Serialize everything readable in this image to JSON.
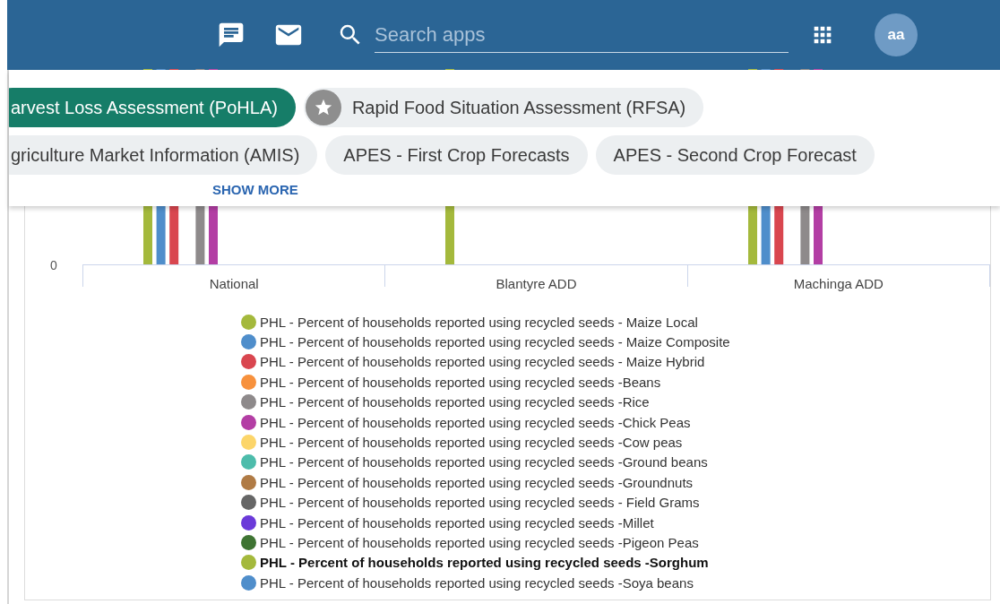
{
  "topbar": {
    "search": {
      "placeholder": "Search apps"
    },
    "avatar": "aa"
  },
  "app_chips": {
    "rows": [
      {
        "chips": [
          {
            "label": "arvest Loss Assessment (PoHLA)",
            "selected": true,
            "kind": "plain"
          },
          {
            "label": "Rapid Food Situation Assessment (RFSA)",
            "selected": false,
            "kind": "starred"
          }
        ]
      },
      {
        "chips": [
          {
            "label": "griculture Market Information (AMIS)",
            "selected": false,
            "kind": "plain"
          },
          {
            "label": "APES - First Crop Forecasts",
            "selected": false,
            "kind": "plain"
          },
          {
            "label": "APES - Second Crop Forecast",
            "selected": false,
            "kind": "plain"
          }
        ]
      }
    ],
    "show_more": "SHOW MORE"
  },
  "chart": {
    "y_tick": "0",
    "categories": [
      "National",
      "Blantyre ADD",
      "Machinga ADD"
    ],
    "legend": [
      {
        "label": "PHL - Percent of households reported using recycled seeds - Maize Local",
        "color": "#a4b93c",
        "highlighted": false
      },
      {
        "label": "PHL - Percent of households reported using recycled seeds - Maize Composite",
        "color": "#4f8ecb",
        "highlighted": false
      },
      {
        "label": "PHL - Percent of households reported using recycled seeds - Maize Hybrid",
        "color": "#d9464f",
        "highlighted": false
      },
      {
        "label": "PHL - Percent of households reported using recycled seeds -Beans",
        "color": "#f7913d",
        "highlighted": false
      },
      {
        "label": "PHL - Percent of households reported using recycled seeds -Rice",
        "color": "#8e8a8b",
        "highlighted": false
      },
      {
        "label": "PHL - Percent of households reported using recycled seeds -Chick Peas",
        "color": "#b33ea4",
        "highlighted": false
      },
      {
        "label": "PHL - Percent of households reported using recycled seeds -Cow peas",
        "color": "#fcd56a",
        "highlighted": false
      },
      {
        "label": "PHL - Percent of households reported using recycled seeds -Ground beans",
        "color": "#4dbcab",
        "highlighted": false
      },
      {
        "label": "PHL - Percent of households reported using recycled seeds -Groundnuts",
        "color": "#b07b45",
        "highlighted": false
      },
      {
        "label": "PHL - Percent of households reported using recycled seeds - Field Grams",
        "color": "#666666",
        "highlighted": false
      },
      {
        "label": "PHL - Percent of households reported using recycled seeds -Millet",
        "color": "#6b3ad9",
        "highlighted": false
      },
      {
        "label": "PHL - Percent of households reported using recycled seeds -Pigeon Peas",
        "color": "#3f7433",
        "highlighted": false
      },
      {
        "label": "PHL - Percent of households reported using recycled seeds -Sorghum",
        "color": "#a4b93c",
        "highlighted": true
      },
      {
        "label": "PHL - Percent of households reported using recycled seeds -Soya beans",
        "color": "#4f8ecb",
        "highlighted": false
      }
    ]
  }
}
